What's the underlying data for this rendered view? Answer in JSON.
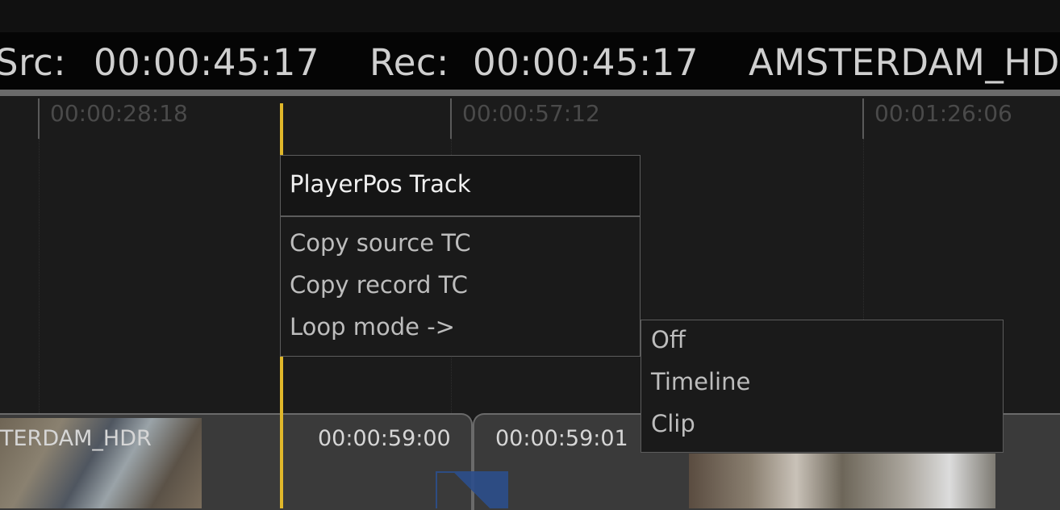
{
  "timecode_bar": {
    "src_label": "Src:",
    "src_value": "00:00:45:17",
    "rec_label": "Rec:",
    "rec_value": "00:00:45:17",
    "clip_name": "AMSTERDAM_HD"
  },
  "ruler": {
    "ticks": [
      "00:00:28:18",
      "00:00:57:12",
      "00:01:26:06"
    ]
  },
  "clips": {
    "left_clip_name": "TERDAM_HDR",
    "left_clip_end_tc": "00:00:59:00",
    "right_clip_start_tc": "00:00:59:01"
  },
  "context_menu": {
    "title": "PlayerPos Track",
    "items": [
      "Copy source TC",
      "Copy record TC",
      "Loop mode ->"
    ]
  },
  "loop_submenu": {
    "items": [
      "Off",
      "Timeline",
      "Clip"
    ]
  },
  "colors": {
    "playhead": "#e0b72a",
    "background": "#1b1b1b",
    "clip": "#3a3a3a"
  }
}
